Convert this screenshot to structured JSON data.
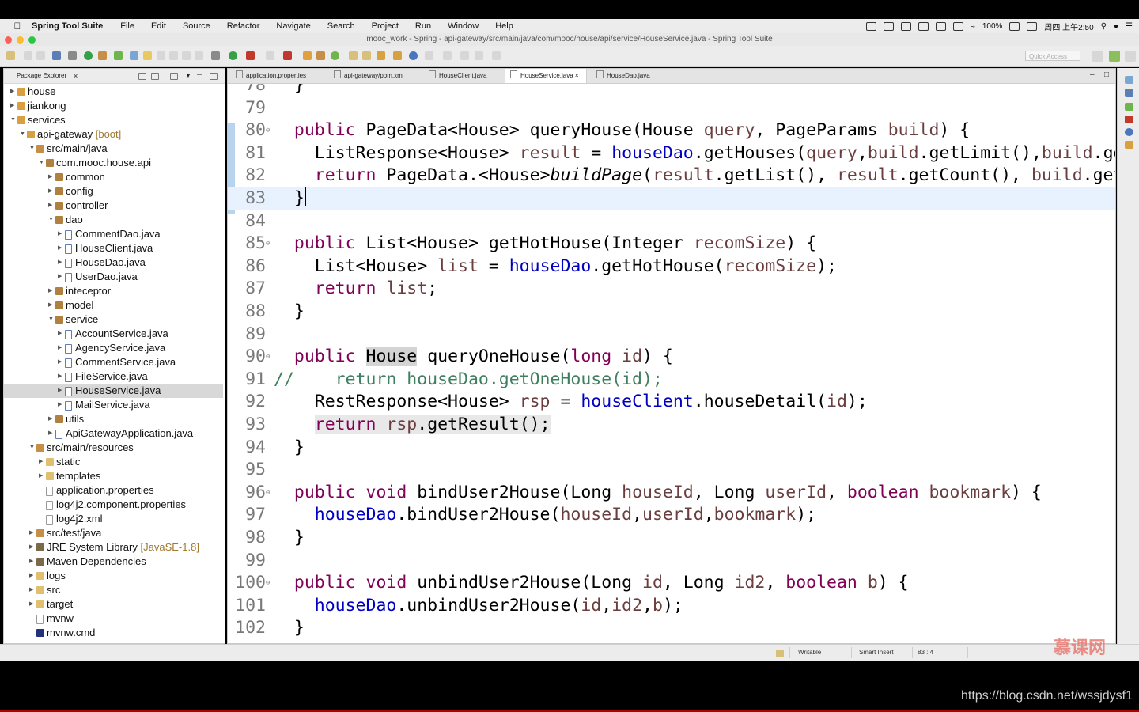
{
  "menubar": {
    "app_name": "Spring Tool Suite",
    "items": [
      "File",
      "Edit",
      "Source",
      "Refactor",
      "Navigate",
      "Search",
      "Project",
      "Run",
      "Window",
      "Help"
    ],
    "battery": "100%",
    "clock": "周四 上午2:50"
  },
  "window": {
    "title": "mooc_work - Spring - api-gateway/src/main/java/com/mooc/house/api/service/HouseService.java - Spring Tool Suite"
  },
  "toolbar": {
    "quick_access_placeholder": "Quick Access"
  },
  "package_explorer": {
    "title": "Package Explorer",
    "items": [
      {
        "label": "house",
        "indent": 0,
        "expanded": false,
        "kind": "project"
      },
      {
        "label": "jiankong",
        "indent": 0,
        "expanded": false,
        "kind": "project"
      },
      {
        "label": "services",
        "indent": 0,
        "expanded": true,
        "kind": "project"
      },
      {
        "label": "api-gateway",
        "suffix": "[boot]",
        "indent": 1,
        "expanded": true,
        "kind": "project"
      },
      {
        "label": "src/main/java",
        "indent": 2,
        "expanded": true,
        "kind": "source-folder"
      },
      {
        "label": "com.mooc.house.api",
        "indent": 3,
        "expanded": true,
        "kind": "package"
      },
      {
        "label": "common",
        "indent": 4,
        "expanded": false,
        "kind": "package"
      },
      {
        "label": "config",
        "indent": 4,
        "expanded": false,
        "kind": "package"
      },
      {
        "label": "controller",
        "indent": 4,
        "expanded": false,
        "kind": "package"
      },
      {
        "label": "dao",
        "indent": 4,
        "expanded": true,
        "kind": "package"
      },
      {
        "label": "CommentDao.java",
        "indent": 5,
        "expanded": false,
        "kind": "java"
      },
      {
        "label": "HouseClient.java",
        "indent": 5,
        "expanded": false,
        "kind": "java"
      },
      {
        "label": "HouseDao.java",
        "indent": 5,
        "expanded": false,
        "kind": "java"
      },
      {
        "label": "UserDao.java",
        "indent": 5,
        "expanded": false,
        "kind": "java"
      },
      {
        "label": "inteceptor",
        "indent": 4,
        "expanded": false,
        "kind": "package"
      },
      {
        "label": "model",
        "indent": 4,
        "expanded": false,
        "kind": "package"
      },
      {
        "label": "service",
        "indent": 4,
        "expanded": true,
        "kind": "package"
      },
      {
        "label": "AccountService.java",
        "indent": 5,
        "expanded": false,
        "kind": "java"
      },
      {
        "label": "AgencyService.java",
        "indent": 5,
        "expanded": false,
        "kind": "java"
      },
      {
        "label": "CommentService.java",
        "indent": 5,
        "expanded": false,
        "kind": "java"
      },
      {
        "label": "FileService.java",
        "indent": 5,
        "expanded": false,
        "kind": "java"
      },
      {
        "label": "HouseService.java",
        "indent": 5,
        "expanded": false,
        "kind": "java",
        "selected": true
      },
      {
        "label": "MailService.java",
        "indent": 5,
        "expanded": false,
        "kind": "java"
      },
      {
        "label": "utils",
        "indent": 4,
        "expanded": false,
        "kind": "package"
      },
      {
        "label": "ApiGatewayApplication.java",
        "indent": 4,
        "expanded": false,
        "kind": "java"
      },
      {
        "label": "src/main/resources",
        "indent": 2,
        "expanded": true,
        "kind": "source-folder"
      },
      {
        "label": "static",
        "indent": 3,
        "expanded": false,
        "kind": "folder"
      },
      {
        "label": "templates",
        "indent": 3,
        "expanded": false,
        "kind": "folder"
      },
      {
        "label": "application.properties",
        "indent": 3,
        "leaf": true,
        "kind": "file"
      },
      {
        "label": "log4j2.component.properties",
        "indent": 3,
        "leaf": true,
        "kind": "file"
      },
      {
        "label": "log4j2.xml",
        "indent": 3,
        "leaf": true,
        "kind": "xml"
      },
      {
        "label": "src/test/java",
        "indent": 2,
        "expanded": false,
        "kind": "source-folder"
      },
      {
        "label": "JRE System Library",
        "suffix": "[JavaSE-1.8]",
        "indent": 2,
        "expanded": false,
        "kind": "library"
      },
      {
        "label": "Maven Dependencies",
        "indent": 2,
        "expanded": false,
        "kind": "library"
      },
      {
        "label": "logs",
        "indent": 2,
        "expanded": false,
        "kind": "folder"
      },
      {
        "label": "src",
        "indent": 2,
        "expanded": false,
        "kind": "folder"
      },
      {
        "label": "target",
        "indent": 2,
        "expanded": false,
        "kind": "folder"
      },
      {
        "label": "mvnw",
        "indent": 2,
        "leaf": true,
        "kind": "file"
      },
      {
        "label": "mvnw.cmd",
        "indent": 2,
        "leaf": true,
        "kind": "cmd"
      }
    ]
  },
  "editor": {
    "tabs": [
      {
        "label": "application.properties"
      },
      {
        "label": "api-gateway/pom.xml"
      },
      {
        "label": "HouseClient.java"
      },
      {
        "label": "HouseService.java",
        "active": true
      },
      {
        "label": "HouseDao.java"
      }
    ],
    "lines": [
      {
        "n": "78",
        "fold": false,
        "tokens": [
          {
            "t": "  }"
          }
        ]
      },
      {
        "n": "79",
        "fold": false,
        "tokens": []
      },
      {
        "n": "80",
        "fold": true,
        "tokens": [
          {
            "t": "  "
          },
          {
            "t": "public",
            "c": "kw"
          },
          {
            "t": " PageData<House> queryHouse(House "
          },
          {
            "t": "query",
            "c": "var"
          },
          {
            "t": ", PageParams "
          },
          {
            "t": "build",
            "c": "var"
          },
          {
            "t": ") {"
          }
        ]
      },
      {
        "n": "81",
        "fold": false,
        "tokens": [
          {
            "t": "    ListResponse<House> "
          },
          {
            "t": "result",
            "c": "var"
          },
          {
            "t": " = "
          },
          {
            "t": "houseDao",
            "c": "fld"
          },
          {
            "t": ".getHouses("
          },
          {
            "t": "query",
            "c": "var"
          },
          {
            "t": ","
          },
          {
            "t": "build",
            "c": "var"
          },
          {
            "t": ".getLimit(),"
          },
          {
            "t": "build",
            "c": "var"
          },
          {
            "t": ".get"
          }
        ]
      },
      {
        "n": "82",
        "fold": false,
        "tokens": [
          {
            "t": "    "
          },
          {
            "t": "return",
            "c": "kw"
          },
          {
            "t": " PageData.<House>"
          },
          {
            "t": "buildPage",
            "c": "ital"
          },
          {
            "t": "("
          },
          {
            "t": "result",
            "c": "var"
          },
          {
            "t": ".getList(), "
          },
          {
            "t": "result",
            "c": "var"
          },
          {
            "t": ".getCount(), "
          },
          {
            "t": "build",
            "c": "var"
          },
          {
            "t": ".getP"
          }
        ]
      },
      {
        "n": "83",
        "fold": false,
        "current": true,
        "tokens": [
          {
            "t": "  }"
          },
          {
            "t": "",
            "c": "caret"
          }
        ]
      },
      {
        "n": "84",
        "fold": false,
        "tokens": []
      },
      {
        "n": "85",
        "fold": true,
        "tokens": [
          {
            "t": "  "
          },
          {
            "t": "public",
            "c": "kw"
          },
          {
            "t": " List<House> getHotHouse(Integer "
          },
          {
            "t": "recomSize",
            "c": "var"
          },
          {
            "t": ") {"
          }
        ]
      },
      {
        "n": "86",
        "fold": false,
        "tokens": [
          {
            "t": "    List<House> "
          },
          {
            "t": "list",
            "c": "var"
          },
          {
            "t": " = "
          },
          {
            "t": "houseDao",
            "c": "fld"
          },
          {
            "t": ".getHotHouse("
          },
          {
            "t": "recomSize",
            "c": "var"
          },
          {
            "t": ");"
          }
        ]
      },
      {
        "n": "87",
        "fold": false,
        "tokens": [
          {
            "t": "    "
          },
          {
            "t": "return",
            "c": "kw"
          },
          {
            "t": " "
          },
          {
            "t": "list",
            "c": "var"
          },
          {
            "t": ";"
          }
        ]
      },
      {
        "n": "88",
        "fold": false,
        "tokens": [
          {
            "t": "  }"
          }
        ]
      },
      {
        "n": "89",
        "fold": false,
        "tokens": []
      },
      {
        "n": "90",
        "fold": true,
        "tokens": [
          {
            "t": "  "
          },
          {
            "t": "public",
            "c": "kw"
          },
          {
            "t": " "
          },
          {
            "t": "House",
            "c": "hl"
          },
          {
            "t": " queryOneHouse("
          },
          {
            "t": "long",
            "c": "kw"
          },
          {
            "t": " "
          },
          {
            "t": "id",
            "c": "var"
          },
          {
            "t": ") {"
          }
        ]
      },
      {
        "n": "91",
        "fold": false,
        "tokens": [
          {
            "t": "//    return houseDao.getOneHouse(id);",
            "c": "cmt"
          }
        ]
      },
      {
        "n": "92",
        "fold": false,
        "tokens": [
          {
            "t": "    RestResponse<House> "
          },
          {
            "t": "rsp",
            "c": "var"
          },
          {
            "t": " = "
          },
          {
            "t": "houseClient",
            "c": "fld"
          },
          {
            "t": ".houseDetail("
          },
          {
            "t": "id",
            "c": "var"
          },
          {
            "t": ");"
          }
        ]
      },
      {
        "n": "93",
        "fold": false,
        "tokens": [
          {
            "t": "    "
          },
          {
            "t": "return",
            "c": "kw hl2"
          },
          {
            "t": " ",
            "c": "hl2"
          },
          {
            "t": "rsp",
            "c": "var hl2"
          },
          {
            "t": ".getResult();",
            "c": "hl2"
          }
        ]
      },
      {
        "n": "94",
        "fold": false,
        "tokens": [
          {
            "t": "  }"
          }
        ]
      },
      {
        "n": "95",
        "fold": false,
        "tokens": []
      },
      {
        "n": "96",
        "fold": true,
        "tokens": [
          {
            "t": "  "
          },
          {
            "t": "public",
            "c": "kw"
          },
          {
            "t": " "
          },
          {
            "t": "void",
            "c": "kw"
          },
          {
            "t": " bindUser2House(Long "
          },
          {
            "t": "houseId",
            "c": "var"
          },
          {
            "t": ", Long "
          },
          {
            "t": "userId",
            "c": "var"
          },
          {
            "t": ", "
          },
          {
            "t": "boolean",
            "c": "kw"
          },
          {
            "t": " "
          },
          {
            "t": "bookmark",
            "c": "var"
          },
          {
            "t": ") {"
          }
        ]
      },
      {
        "n": "97",
        "fold": false,
        "tokens": [
          {
            "t": "    "
          },
          {
            "t": "houseDao",
            "c": "fld"
          },
          {
            "t": ".bindUser2House("
          },
          {
            "t": "houseId",
            "c": "var"
          },
          {
            "t": ","
          },
          {
            "t": "userId",
            "c": "var"
          },
          {
            "t": ","
          },
          {
            "t": "bookmark",
            "c": "var"
          },
          {
            "t": ");"
          }
        ]
      },
      {
        "n": "98",
        "fold": false,
        "tokens": [
          {
            "t": "  }"
          }
        ]
      },
      {
        "n": "99",
        "fold": false,
        "tokens": []
      },
      {
        "n": "100",
        "fold": true,
        "tokens": [
          {
            "t": "  "
          },
          {
            "t": "public",
            "c": "kw"
          },
          {
            "t": " "
          },
          {
            "t": "void",
            "c": "kw"
          },
          {
            "t": " unbindUser2House(Long "
          },
          {
            "t": "id",
            "c": "var"
          },
          {
            "t": ", Long "
          },
          {
            "t": "id2",
            "c": "var"
          },
          {
            "t": ", "
          },
          {
            "t": "boolean",
            "c": "kw"
          },
          {
            "t": " "
          },
          {
            "t": "b",
            "c": "var"
          },
          {
            "t": ") {"
          }
        ]
      },
      {
        "n": "101",
        "fold": false,
        "tokens": [
          {
            "t": "    "
          },
          {
            "t": "houseDao",
            "c": "fld"
          },
          {
            "t": ".unbindUser2House("
          },
          {
            "t": "id",
            "c": "var"
          },
          {
            "t": ","
          },
          {
            "t": "id2",
            "c": "var"
          },
          {
            "t": ","
          },
          {
            "t": "b",
            "c": "var"
          },
          {
            "t": ");"
          }
        ]
      },
      {
        "n": "102",
        "fold": false,
        "tokens": [
          {
            "t": "  }"
          }
        ]
      }
    ]
  },
  "statusbar": {
    "writable": "Writable",
    "insert_mode": "Smart Insert",
    "position": "83 : 4"
  },
  "watermark": "慕课网",
  "url": "https://blog.csdn.net/wssjdysf1",
  "colors": {
    "keyword": "#7f0055",
    "field": "#0000c0",
    "local_var": "#6a3e3e",
    "comment": "#3f7f5f",
    "current_line": "#e8f2fe",
    "selection": "#d8d8d8"
  }
}
